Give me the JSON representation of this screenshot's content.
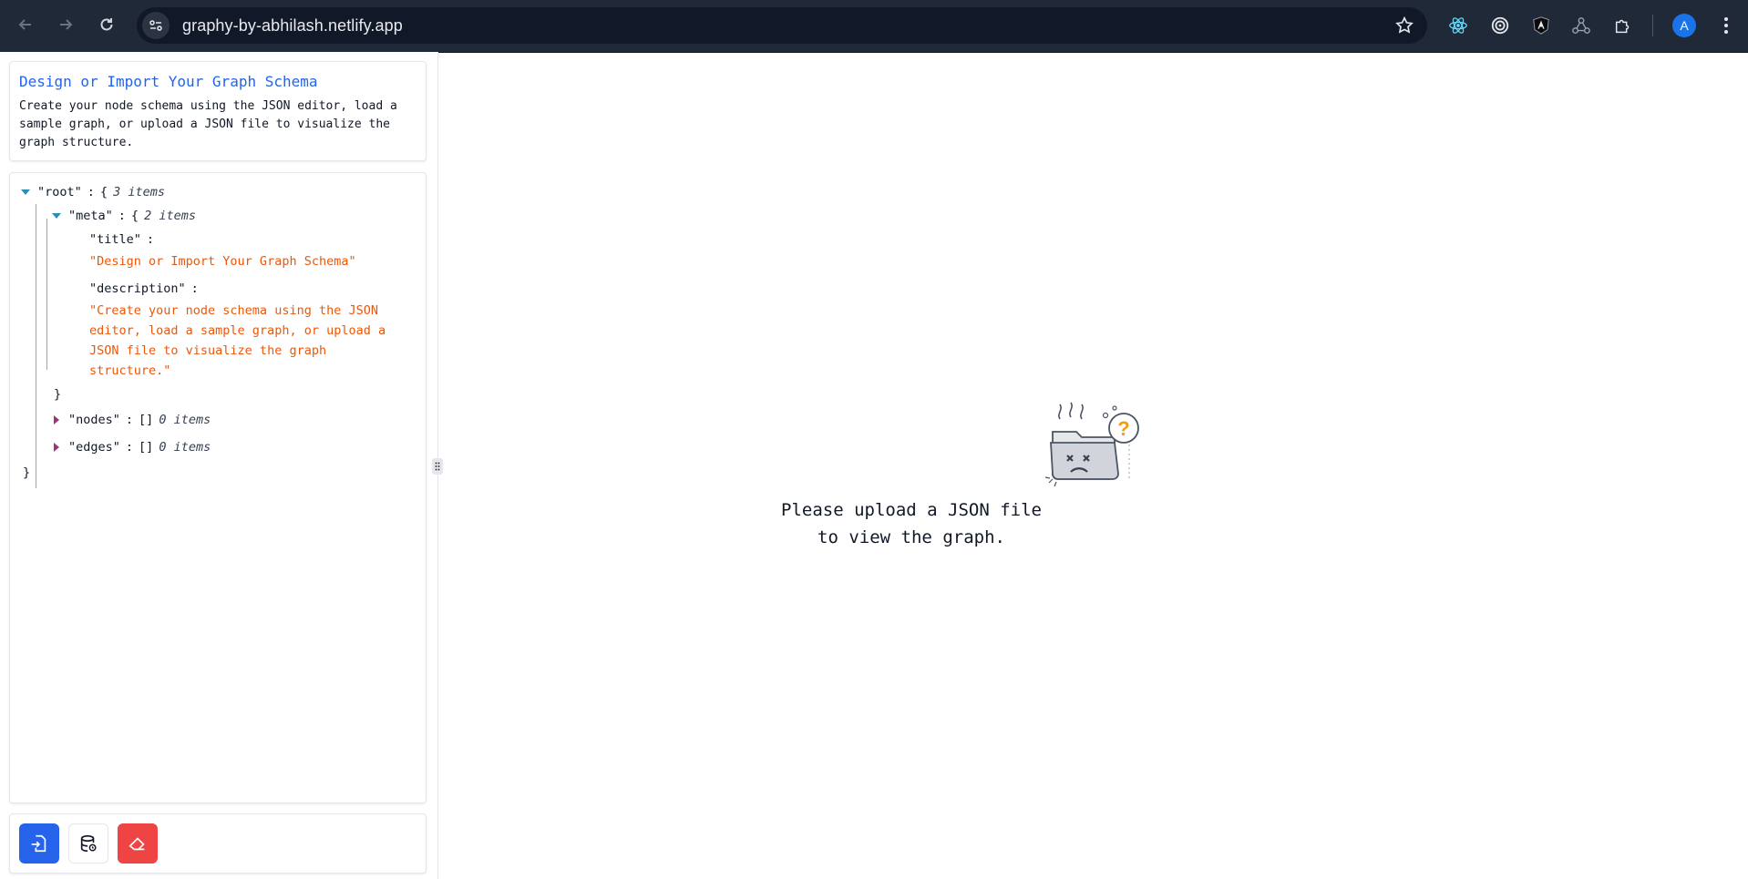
{
  "browser": {
    "url": "graphy-by-abhilash.netlify.app",
    "avatar_letter": "A",
    "extensions": [
      "react-icon",
      "target-icon",
      "angular-icon",
      "graph-icon",
      "puzzle-icon"
    ]
  },
  "intro": {
    "title": "Design or Import Your Graph Schema",
    "description": "Create your node schema using the JSON editor, load a sample graph, or upload a JSON file to visualize the graph structure."
  },
  "json_tree": {
    "root_key": "\"root\"",
    "root_count": "3 items",
    "meta_key": "\"meta\"",
    "meta_count": "2 items",
    "title_key": "\"title\"",
    "title_value": "\"Design or Import Your Graph Schema\"",
    "description_key": "\"description\"",
    "description_value": "\"Create your node schema using the JSON editor, load a sample graph, or upload a JSON file to visualize the graph structure.\"",
    "nodes_key": "\"nodes\"",
    "nodes_count": "0 items",
    "edges_key": "\"edges\"",
    "edges_count": "0 items",
    "colon": ":",
    "open_brace": "{",
    "close_brace": "}",
    "empty_array": "[]"
  },
  "empty_state": {
    "line1": "Please upload a JSON file",
    "line2": "to view the graph."
  },
  "colors": {
    "accent": "#2563eb",
    "danger": "#ef4444",
    "string": "#ea580c"
  }
}
